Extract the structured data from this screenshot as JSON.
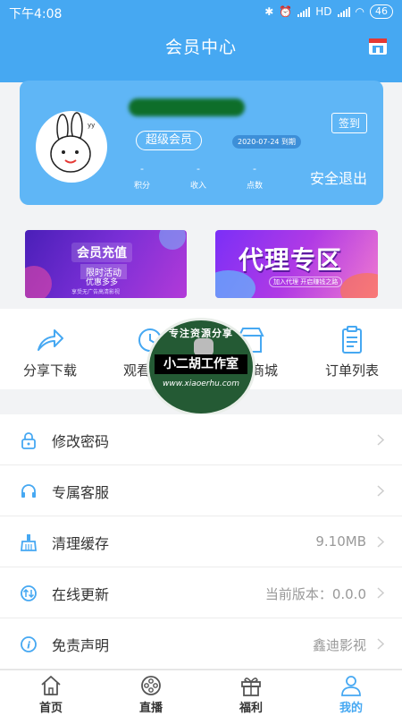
{
  "status_bar": {
    "time": "下午4:08",
    "net": "HD",
    "battery": "46"
  },
  "header": {
    "title": "会员中心",
    "calendar_icon": "calendar-icon"
  },
  "member": {
    "vip_label": "超级会员",
    "expiry": "2020-07-24 到期",
    "stats": [
      {
        "value": "-",
        "label": "积分"
      },
      {
        "value": "-",
        "label": "收入"
      },
      {
        "value": "-",
        "label": "点数"
      }
    ],
    "signin_label": "签到",
    "logout_label": "安全退出"
  },
  "banners": {
    "recharge": {
      "title": "会员充值",
      "sub1": "限时活动",
      "sub2": "优惠多多",
      "foot": "享受无广告高清影视"
    },
    "agent": {
      "title": "代理专区",
      "foot": "加入代理  开启赚钱之路"
    }
  },
  "quick_actions": [
    {
      "label": "分享下载",
      "icon": "share-icon"
    },
    {
      "label": "观看记录",
      "icon": "history-icon"
    },
    {
      "label": "积分商城",
      "icon": "store-icon"
    },
    {
      "label": "订单列表",
      "icon": "clipboard-icon"
    }
  ],
  "watermark": {
    "top": "专注资源分享",
    "band": "小二胡工作室",
    "url": "www.xiaoerhu.com"
  },
  "settings": [
    {
      "label": "修改密码",
      "value": "",
      "icon": "lock-icon"
    },
    {
      "label": "专属客服",
      "value": "",
      "icon": "headset-icon"
    },
    {
      "label": "清理缓存",
      "value": "9.10MB",
      "icon": "broom-icon"
    },
    {
      "label": "在线更新",
      "value": "当前版本：0.0.0",
      "icon": "update-icon"
    },
    {
      "label": "免责声明",
      "value": "鑫迪影视",
      "icon": "info-icon"
    }
  ],
  "nav": [
    {
      "label": "首页",
      "icon": "home-icon"
    },
    {
      "label": "直播",
      "icon": "film-reel-icon"
    },
    {
      "label": "福利",
      "icon": "gift-icon"
    },
    {
      "label": "我的",
      "icon": "user-icon",
      "active": true
    }
  ],
  "colors": {
    "accent": "#46a8f2",
    "card": "#5fb6f6"
  }
}
